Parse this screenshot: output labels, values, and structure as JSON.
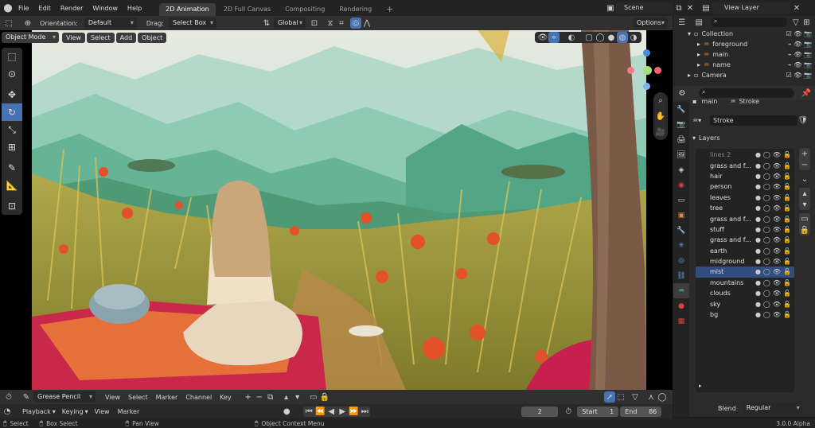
{
  "menu": [
    "File",
    "Edit",
    "Render",
    "Window",
    "Help"
  ],
  "workspaces": [
    {
      "label": "2D Animation",
      "active": true
    },
    {
      "label": "2D Full Canvas",
      "active": false
    },
    {
      "label": "Compositing",
      "active": false
    },
    {
      "label": "Rendering",
      "active": false
    }
  ],
  "scene": {
    "label": "Scene",
    "view_layer": "View Layer"
  },
  "header": {
    "orientation_label": "Orientation:",
    "orientation_value": "Default",
    "drag_label": "Drag:",
    "drag_value": "Select Box",
    "transform_value": "Global",
    "options_label": "Options"
  },
  "viewport_header": {
    "mode": "Object Mode",
    "items": [
      "View",
      "Select",
      "Add",
      "Object"
    ]
  },
  "outliner": {
    "search_placeholder": "",
    "rows": [
      {
        "label": "Collection",
        "indent": 0
      },
      {
        "label": "foreground",
        "indent": 1
      },
      {
        "label": "main",
        "indent": 1
      },
      {
        "label": "name",
        "indent": 1
      },
      {
        "label": "Camera",
        "indent": 0
      }
    ]
  },
  "properties": {
    "breadcrumb_object": "main",
    "breadcrumb_data": "Stroke",
    "data_name": "Stroke",
    "layers_title": "Layers",
    "layers": [
      "lines 2",
      "grass and f...",
      "hair",
      "person",
      "leaves",
      "tree",
      "grass and f...",
      "stuff",
      "grass and f...",
      "earth",
      "midground",
      "mist",
      "mountains",
      "clouds",
      "sky",
      "bg"
    ],
    "selected_layer": "mist",
    "blend_label": "Blend",
    "blend_value": "Regular"
  },
  "timeline_header": {
    "editor": "Grease Pencil",
    "items": [
      "View",
      "Select",
      "Marker",
      "Channel",
      "Key"
    ]
  },
  "timeline": {
    "playback": "Playback",
    "keying": "Keying",
    "view": "View",
    "marker": "Marker",
    "current_frame": "2",
    "start_label": "Start",
    "start_value": "1",
    "end_label": "End",
    "end_value": "86"
  },
  "statusbar": {
    "select": "Select",
    "box_select": "Box Select",
    "pan_view": "Pan View",
    "context_menu": "Object Context Menu",
    "version": "3.0.0 Alpha"
  },
  "colors": {
    "accent": "#4772b3",
    "selected_row": "#334d80"
  }
}
